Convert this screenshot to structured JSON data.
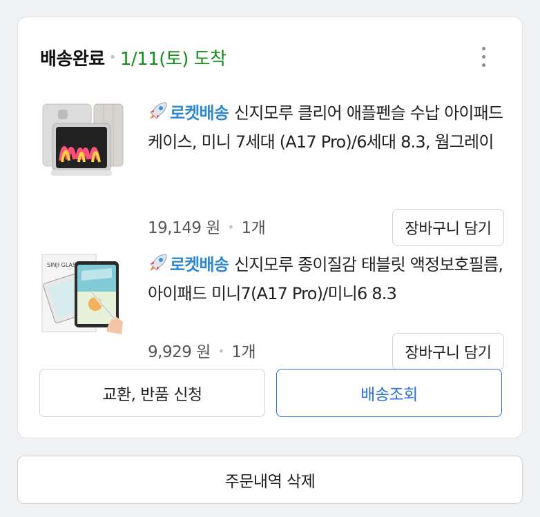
{
  "order": {
    "status": "배송완료",
    "arrival": "1/11(토) 도착",
    "more_icon": "more-vertical-icon",
    "colors": {
      "arrival": "#148f1c",
      "rocket_label": "#2d87d4",
      "track_button": "#2e6fe0"
    },
    "items": [
      {
        "badge": "로켓배송",
        "badge_icon": "rocket-icon",
        "title": "신지모루 클리어 애플펜슬 수납 아이패드 케이스, 미니 7세대 (A17 Pro)/6세대 8.3, 웜그레이",
        "price": "19,149 원",
        "quantity": "1개",
        "cart_button": "장바구니 담기"
      },
      {
        "badge": "로켓배송",
        "badge_icon": "rocket-icon",
        "title": "신지모루 종이질감 태블릿 액정보호필름, 아이패드 미니7(A17 Pro)/미니6 8.3",
        "image_text": "SINJI GLASS",
        "price": "9,929 원",
        "quantity": "1개",
        "cart_button": "장바구니 담기"
      }
    ],
    "buttons": {
      "exchange": "교환, 반품 신청",
      "track": "배송조회"
    }
  },
  "footer": {
    "delete_button": "주문내역 삭제"
  }
}
